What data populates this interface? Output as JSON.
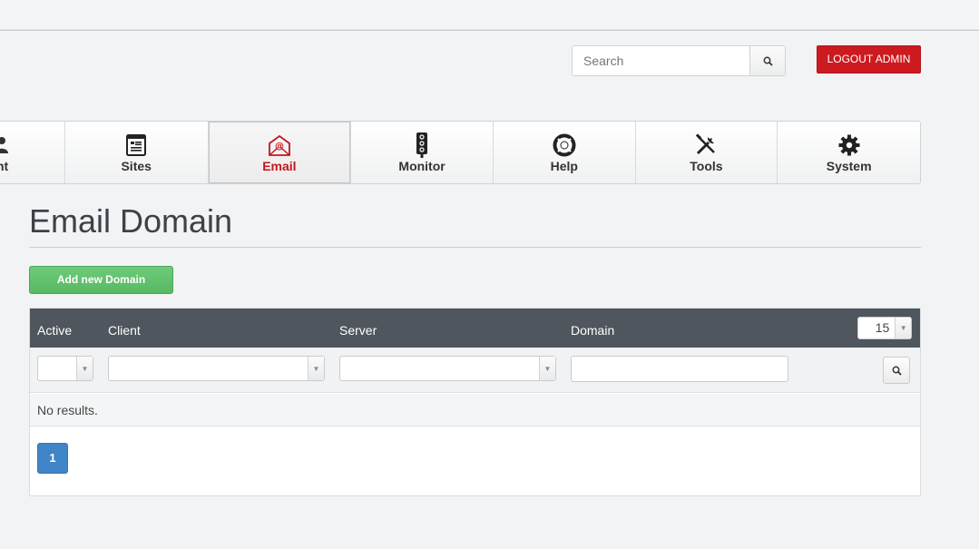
{
  "header": {
    "search": {
      "placeholder": "Search",
      "value": ""
    },
    "logout_label": "LOGOUT ADMIN"
  },
  "nav": {
    "items": [
      {
        "label": "nt",
        "icon": "users-icon",
        "active": false
      },
      {
        "label": "Sites",
        "icon": "sites-icon",
        "active": false
      },
      {
        "label": "Email",
        "icon": "email-icon",
        "active": true
      },
      {
        "label": "Monitor",
        "icon": "traffic-light-icon",
        "active": false
      },
      {
        "label": "Help",
        "icon": "lifebuoy-icon",
        "active": false
      },
      {
        "label": "Tools",
        "icon": "tools-icon",
        "active": false
      },
      {
        "label": "System",
        "icon": "gear-icon",
        "active": false
      }
    ]
  },
  "page": {
    "title": "Email Domain",
    "add_button": "Add new Domain"
  },
  "grid": {
    "columns": [
      "Active",
      "Client",
      "Server",
      "Domain"
    ],
    "page_size": "15",
    "filters": {
      "active": "",
      "client": "",
      "server": "",
      "domain": ""
    },
    "empty_text": "No results.",
    "pages": [
      "1"
    ],
    "current_page": "1"
  },
  "colors": {
    "accent_red": "#cc1a1f",
    "header_dark": "#4f565d",
    "add_green": "#5cbd68",
    "page_blue": "#3f85c7"
  }
}
